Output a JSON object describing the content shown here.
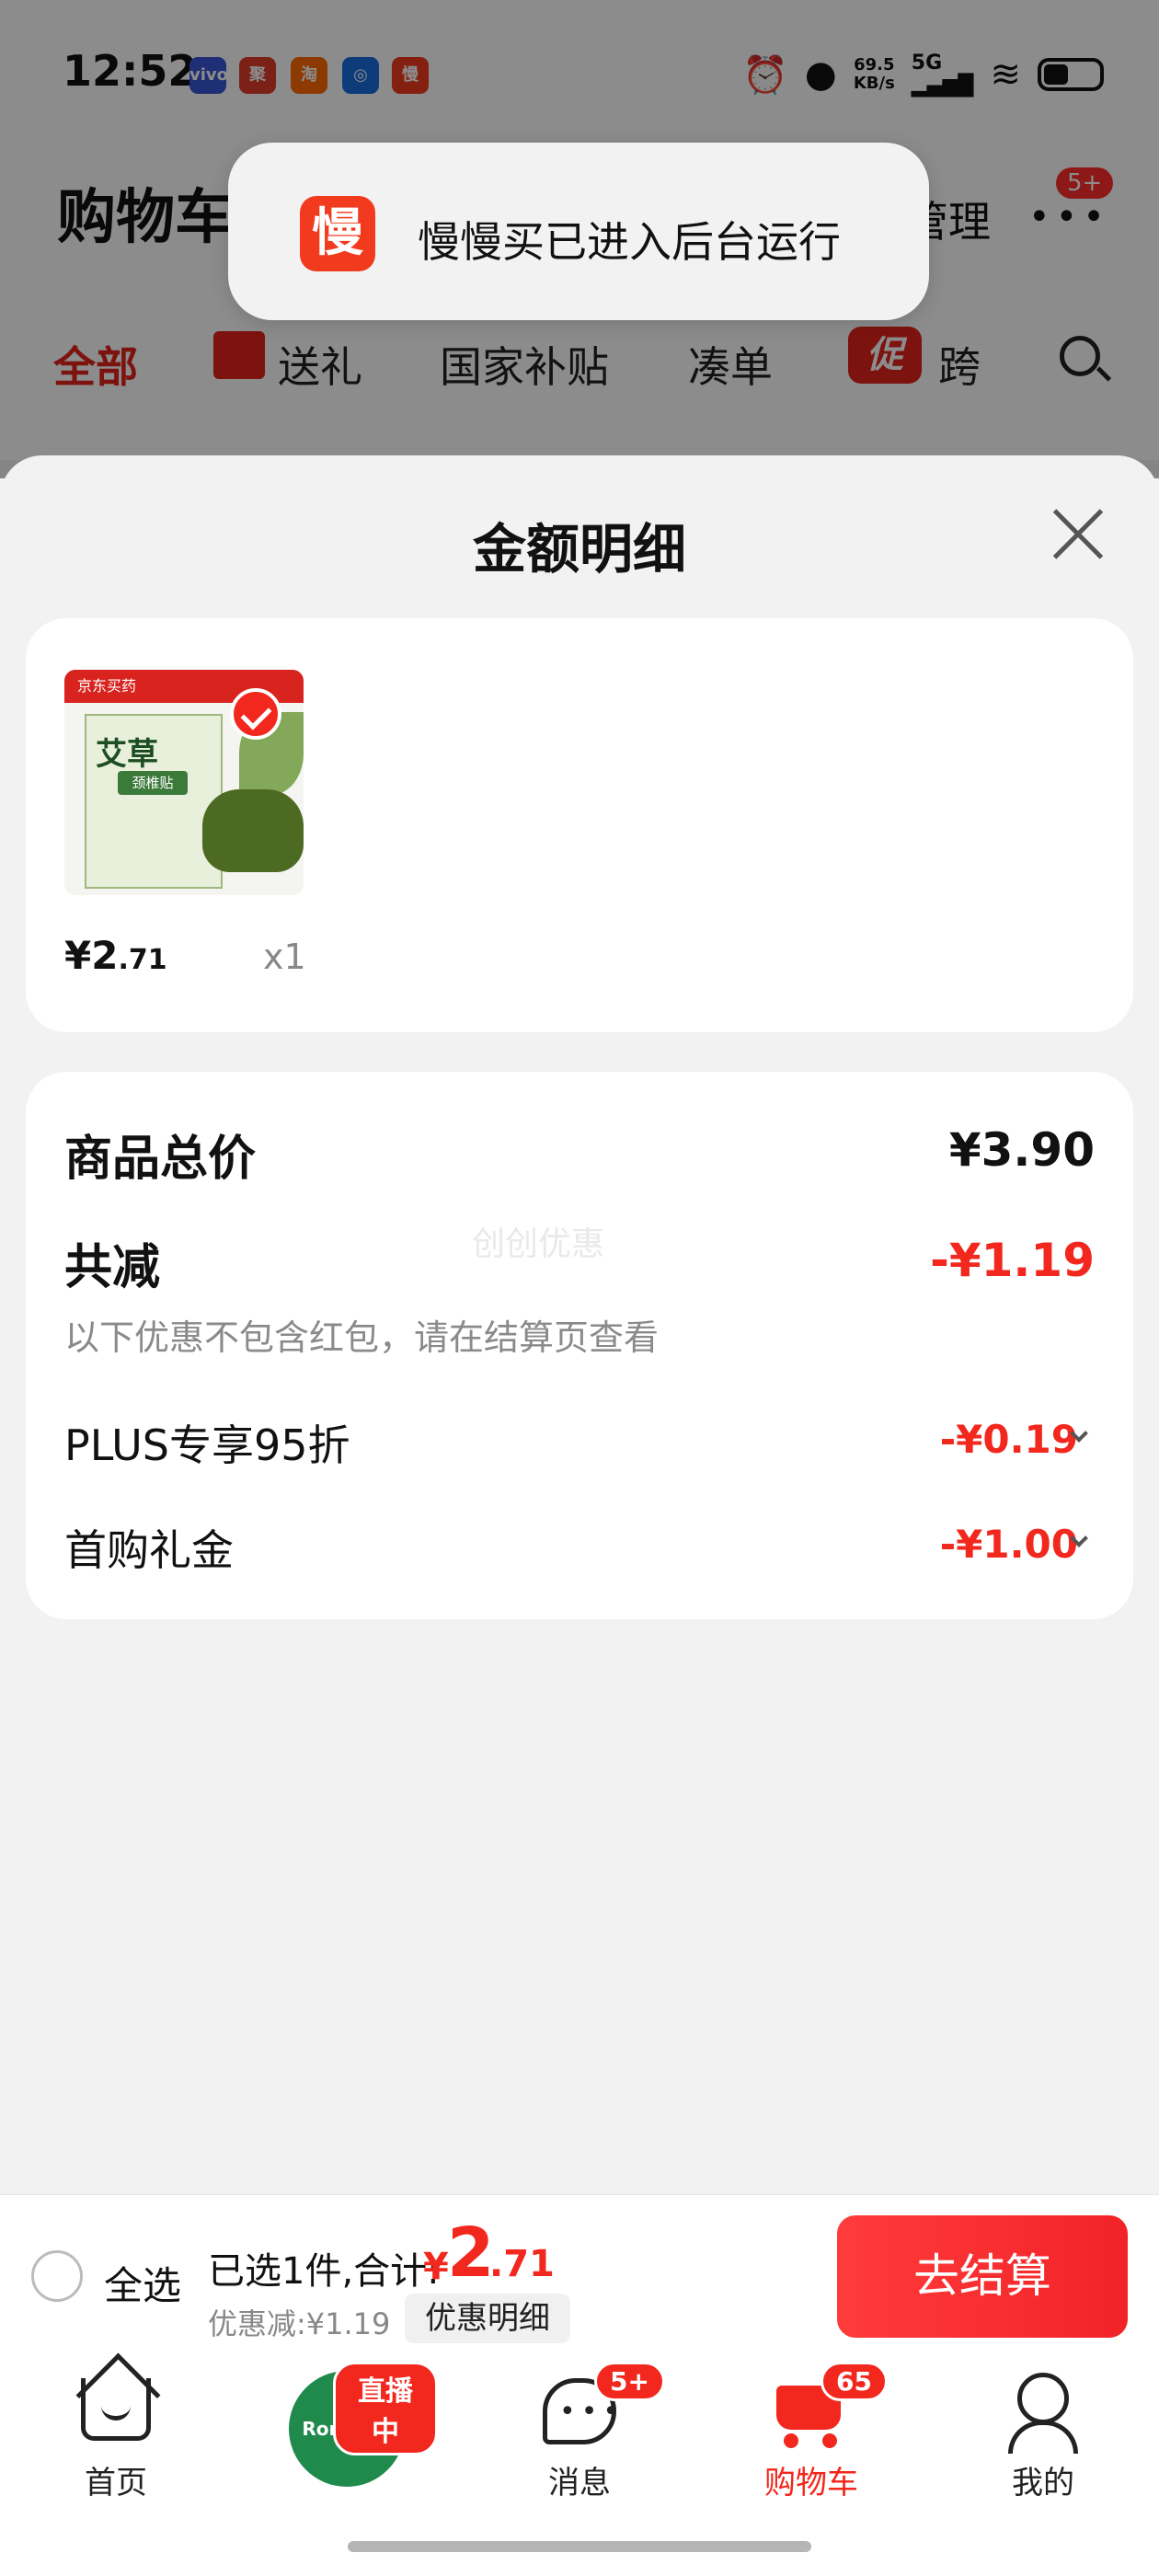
{
  "status_bar": {
    "time": "12:52",
    "apps": [
      "vivo",
      "聚",
      "淘",
      "◎",
      "慢"
    ],
    "net_speed_value": "69.5",
    "net_speed_unit": "KB/s",
    "net_type": "5G",
    "icons": [
      "alarm-icon",
      "location-icon",
      "signal-icon",
      "wifi-icon",
      "battery-icon"
    ]
  },
  "background_page": {
    "title": "购物车",
    "manage": "管理",
    "more_badge": "5+",
    "categories": [
      "全部",
      "送礼",
      "国家补贴",
      "凑单",
      "跨"
    ],
    "promo_tag": "促"
  },
  "toast": {
    "icon_text": "慢",
    "message": "慢慢买已进入后台运行"
  },
  "sheet": {
    "title": "金额明细",
    "product": {
      "price_symbol": "¥",
      "price_int": "2",
      "price_dec": ".71",
      "quantity": "x1",
      "image_brand": "京东买药",
      "image_title": "艾草",
      "image_sub": "颈椎贴"
    },
    "summary": {
      "total_label": "商品总价",
      "total_value": "¥3.90",
      "reduce_label": "共减",
      "reduce_value": "-¥1.19",
      "note": "以下优惠不包含红包，请在结算页查看",
      "watermark": "创创优惠",
      "discounts": [
        {
          "label": "PLUS专享95折",
          "value": "-¥0.19"
        },
        {
          "label": "首购礼金",
          "value": "-¥1.00"
        }
      ]
    }
  },
  "checkout": {
    "select_all": "全选",
    "selected_text": "已选1件,合计:",
    "total_symbol": "¥",
    "total_int": "2",
    "total_dec": ".71",
    "saved_text": "优惠减:¥1.19",
    "detail_button": "优惠明细",
    "checkout_button": "去结算"
  },
  "bottom_nav": {
    "items": [
      {
        "label": "首页",
        "icon": "home-icon"
      },
      {
        "label": "",
        "icon": "live-avatar",
        "badge": "直播中",
        "avatar_text": "Ronshen"
      },
      {
        "label": "消息",
        "icon": "message-icon",
        "badge": "5+"
      },
      {
        "label": "购物车",
        "icon": "cart-icon",
        "badge": "65"
      },
      {
        "label": "我的",
        "icon": "profile-icon"
      }
    ]
  },
  "colors": {
    "accent": "#f2271d",
    "sheet_bg": "#f2f2f2",
    "toast_icon": "#f23a1e"
  }
}
